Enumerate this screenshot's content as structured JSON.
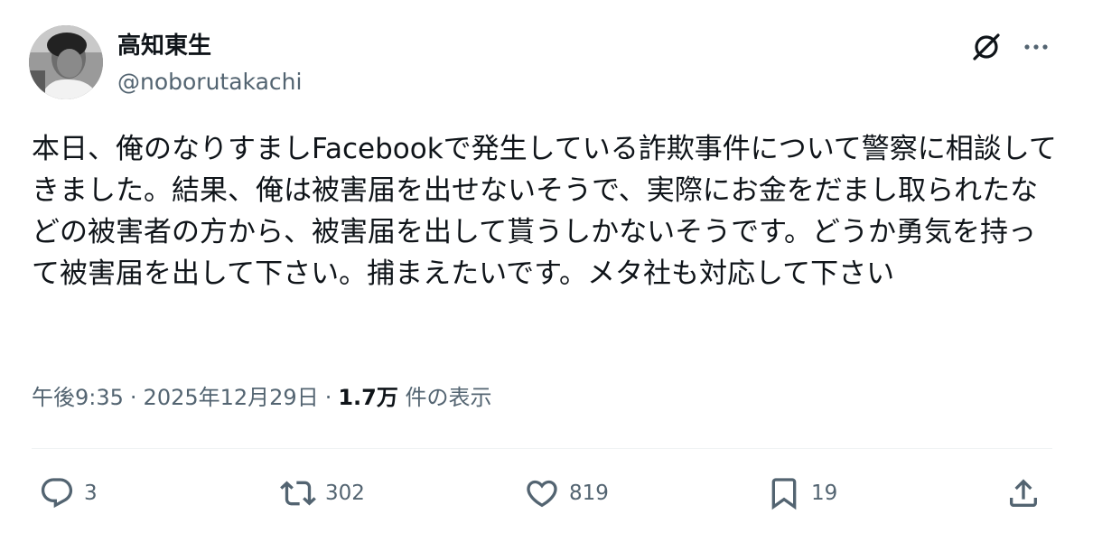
{
  "author": {
    "display_name": "高知東生",
    "handle": "@noborutakachi"
  },
  "tweet": {
    "text": "本日、俺のなりすましFacebookで発生している詐欺事件について警察に相談してきました。結果、俺は被害届を出せないそうで、実際にお金をだまし取られたなどの被害者の方から、被害届を出して貰うしかないそうです。どうか勇気を持って被害届を出して下さい。捕まえたいです。メタ社も対応して下さい",
    "time": "午後9:35",
    "date": "2025年12月29日",
    "separator": "·",
    "views_count": "1.7万",
    "views_label": " 件の表示"
  },
  "actions": {
    "reply_count": "3",
    "retweet_count": "302",
    "like_count": "819",
    "bookmark_count": "19"
  },
  "icons": {
    "grok": "grok-icon",
    "more": "more-icon",
    "reply": "reply-icon",
    "retweet": "retweet-icon",
    "like": "heart-icon",
    "bookmark": "bookmark-icon",
    "share": "share-icon"
  },
  "colors": {
    "text_primary": "#0f1419",
    "text_secondary": "#536471",
    "divider": "#eff3f4"
  }
}
